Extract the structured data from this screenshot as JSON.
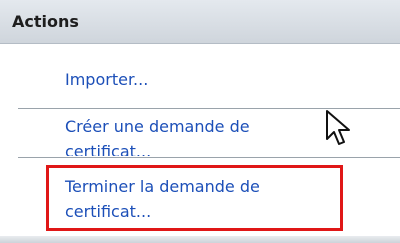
{
  "panel": {
    "title": "Actions"
  },
  "actions": [
    {
      "label_line1": "Importer..."
    },
    {
      "label_line1": "Créer une demande de",
      "label_line2": "certificat..."
    },
    {
      "label_line1": "Terminer la demande de",
      "label_line2": "certificat..."
    }
  ],
  "cursor": {
    "icon": "mouse-pointer-icon"
  },
  "highlight": {
    "color": "#e01717"
  }
}
